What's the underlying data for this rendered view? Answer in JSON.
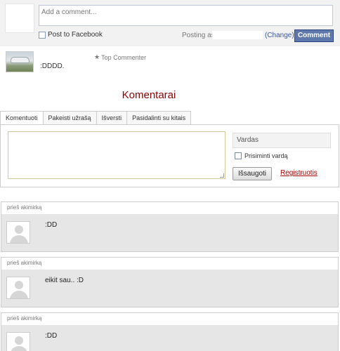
{
  "fb": {
    "input_placeholder": "Add a comment...",
    "post_to_facebook": "Post to Facebook",
    "posting_as": "Posting as",
    "change": "(Change)",
    "comment_button": "Comment",
    "existing_comment": {
      "badge": "Top Commenter",
      "text": ":DDDD."
    }
  },
  "section": {
    "title": "Komentarai",
    "tabs": [
      "Komentuoti",
      "Pakeisti užrašą",
      "Išversti",
      "Pasidalinti su kitais"
    ],
    "form": {
      "name_placeholder": "Vardas",
      "remember_label": "Prisiminti vardą",
      "save_button": "Išsaugoti",
      "register_link": "Registruotis"
    }
  },
  "comments": [
    {
      "time": "prieš akimirką",
      "text": ":DD"
    },
    {
      "time": "prieš akimirką",
      "text": "eikit sau.. :D"
    },
    {
      "time": "prieš akimirką",
      "text": ":DD"
    }
  ],
  "colors": {
    "fb_button": "#5f78ab",
    "fb_link": "#3b5998",
    "title": "#8b0000",
    "register": "#aa0000"
  }
}
